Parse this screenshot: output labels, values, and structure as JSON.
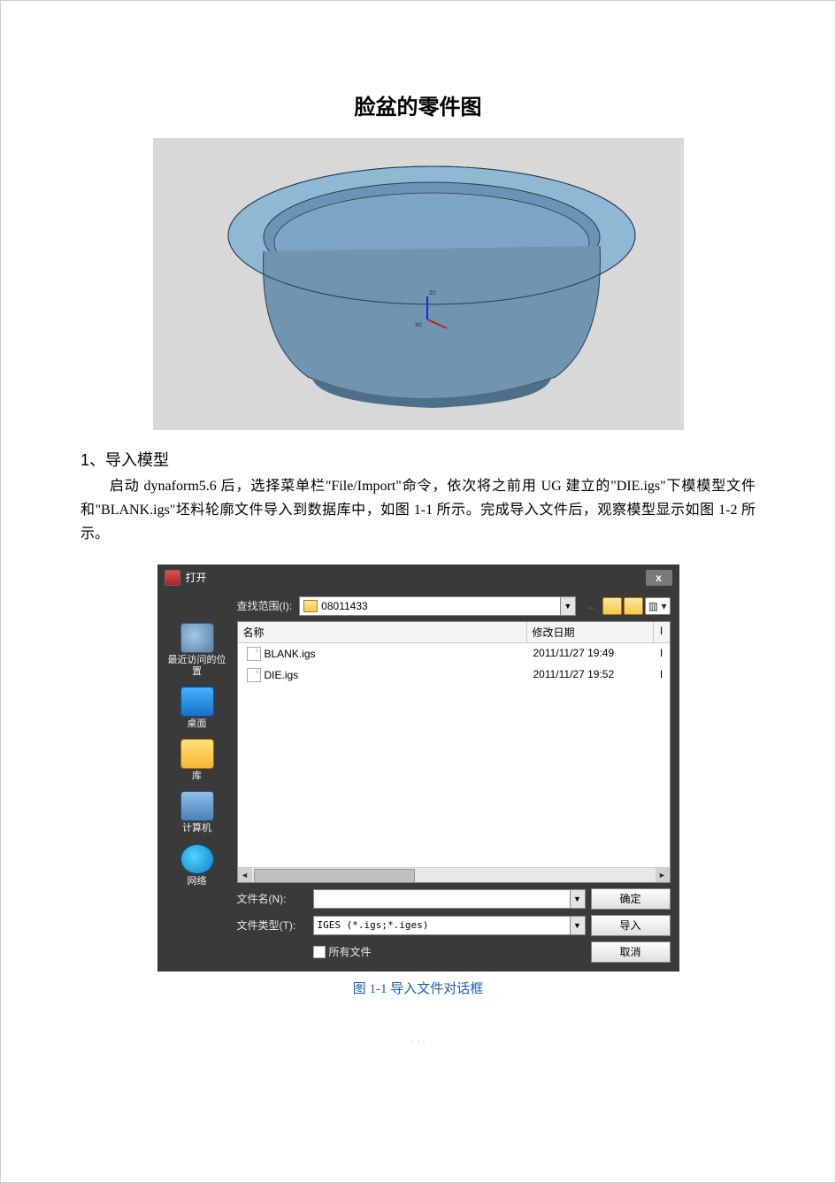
{
  "doc": {
    "title": "脸盆的零件图",
    "section1_title": "1、导入模型",
    "paragraph1": "启动 dynaform5.6 后，选择菜单栏\"File/Import\"命令，依次将之前用 UG 建立的\"DIE.igs\"下模模型文件和\"BLANK.igs\"坯料轮廓文件导入到数据库中，如图 1-1 所示。完成导入文件后，观察模型显示如图 1-2 所示。",
    "figure1_caption": "图 1-1 导入文件对话框",
    "footer": ". . ."
  },
  "dialog": {
    "title": "打开",
    "close": "x",
    "lookin_label": "查找范围(I):",
    "lookin_value": "08011433",
    "toolbar": {
      "back": "←",
      "view": "▥ ▾"
    },
    "columns": {
      "name": "名称",
      "date": "修改日期",
      "type": "I"
    },
    "files": [
      {
        "name": "BLANK.igs",
        "date": "2011/11/27 19:49",
        "type": "I"
      },
      {
        "name": "DIE.igs",
        "date": "2011/11/27 19:52",
        "type": "I"
      }
    ],
    "sidebar": [
      {
        "key": "recent",
        "label": "最近访问的位置"
      },
      {
        "key": "desktop",
        "label": "桌面"
      },
      {
        "key": "library",
        "label": "库"
      },
      {
        "key": "computer",
        "label": "计算机"
      },
      {
        "key": "network",
        "label": "网络"
      }
    ],
    "filename_label": "文件名(N):",
    "filename_value": "",
    "filetype_label": "文件类型(T):",
    "filetype_value": "IGES (*.igs;*.iges)",
    "allfiles_label": "所有文件",
    "buttons": {
      "ok": "确定",
      "import": "导入",
      "cancel": "取消"
    }
  },
  "cad": {
    "axes": {
      "z": "zc",
      "x": "xc"
    }
  }
}
